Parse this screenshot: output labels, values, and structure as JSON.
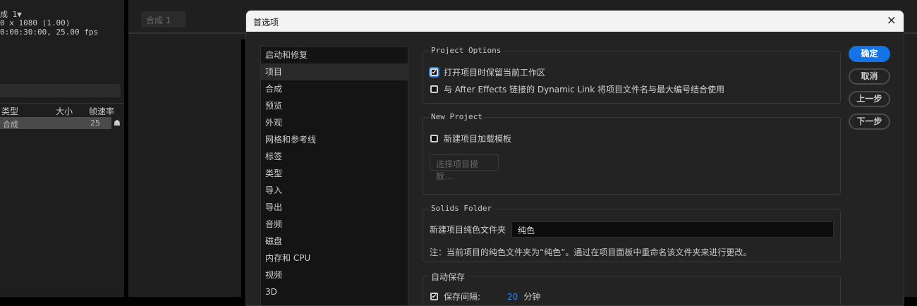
{
  "left_panel": {
    "comp_name": "成 1▼",
    "resolution": "0 x 1080 (1.00)",
    "duration": "0:00:30:00, 25.00 fps",
    "columns": [
      "类型",
      "大小",
      "帧速率"
    ],
    "row": {
      "type": "合成",
      "fps": "25"
    }
  },
  "middle": {
    "tab": "合成 1"
  },
  "dialog": {
    "title": "首选项",
    "close": "×",
    "categories": [
      "启动和修复",
      "项目",
      "合成",
      "预览",
      "外观",
      "网格和参考线",
      "标签",
      "类型",
      "导入",
      "导出",
      "音频",
      "磁盘",
      "内存和 CPU",
      "视频",
      "3D"
    ],
    "selected_index": 1,
    "project_options": {
      "label": "Project Options",
      "opt1": "打开项目时保留当前工作区",
      "opt1_checked": true,
      "opt2": "与 After Effects 链接的 Dynamic Link 将项目文件名与最大编号结合使用",
      "opt2_checked": false
    },
    "new_project": {
      "label": "New Project",
      "opt": "新建项目加载模板",
      "opt_checked": false,
      "choose_button": "选择项目模板…"
    },
    "solids_folder": {
      "label": "Solids Folder",
      "field_label": "新建项目纯色文件夹",
      "field_value": "纯色",
      "note": "注：当前项目的纯色文件夹为“纯色”。通过在项目面板中重命名该文件夹来进行更改。"
    },
    "autosave": {
      "label": "自动保存",
      "interval_label": "保存间隔:",
      "interval_value": "20",
      "interval_unit": "分钟",
      "checked": true
    },
    "buttons": {
      "ok": "确定",
      "cancel": "取消",
      "prev": "上一步",
      "next": "下一步"
    },
    "accent": "#1473e6"
  }
}
